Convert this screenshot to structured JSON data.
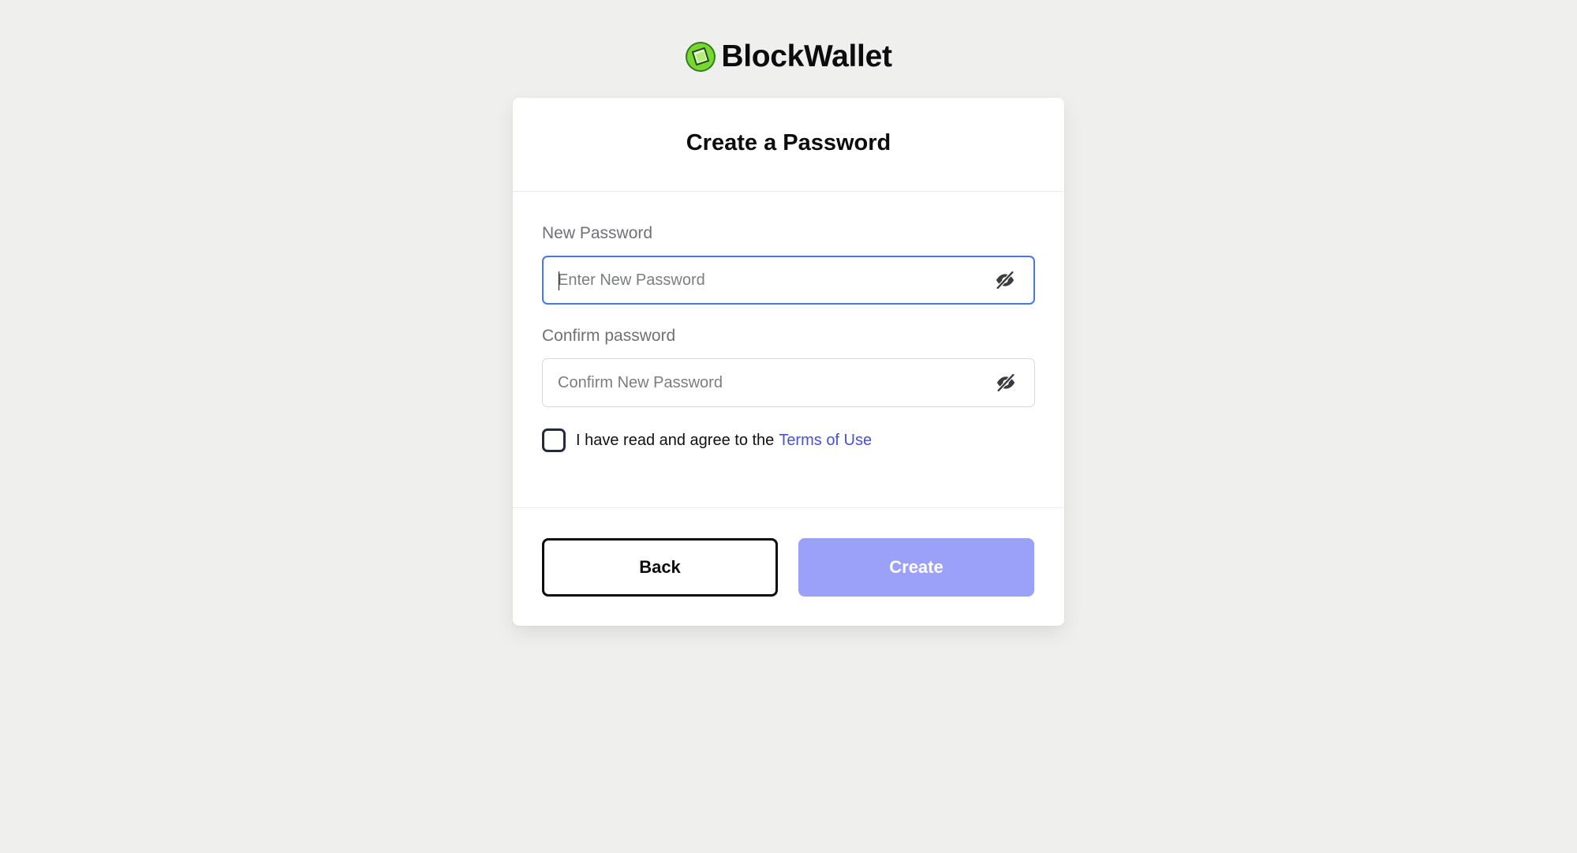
{
  "app": {
    "name": "BlockWallet"
  },
  "card": {
    "title": "Create a Password"
  },
  "form": {
    "new_password": {
      "label": "New Password",
      "placeholder": "Enter New Password",
      "value": ""
    },
    "confirm_password": {
      "label": "Confirm password",
      "placeholder": "Confirm New Password",
      "value": ""
    },
    "agree": {
      "text": "I have read and agree to the",
      "link_text": "Terms of Use",
      "checked": false
    }
  },
  "buttons": {
    "back_label": "Back",
    "create_label": "Create"
  },
  "icons": {
    "brand": "blockwallet-logo-icon",
    "password_toggle": "eye-slash-icon"
  },
  "colors": {
    "background": "#eff0ee",
    "primary": "#9ba0f8",
    "link": "#4650d8",
    "focus": "#4677e6",
    "logo_green": "#7ad631"
  }
}
